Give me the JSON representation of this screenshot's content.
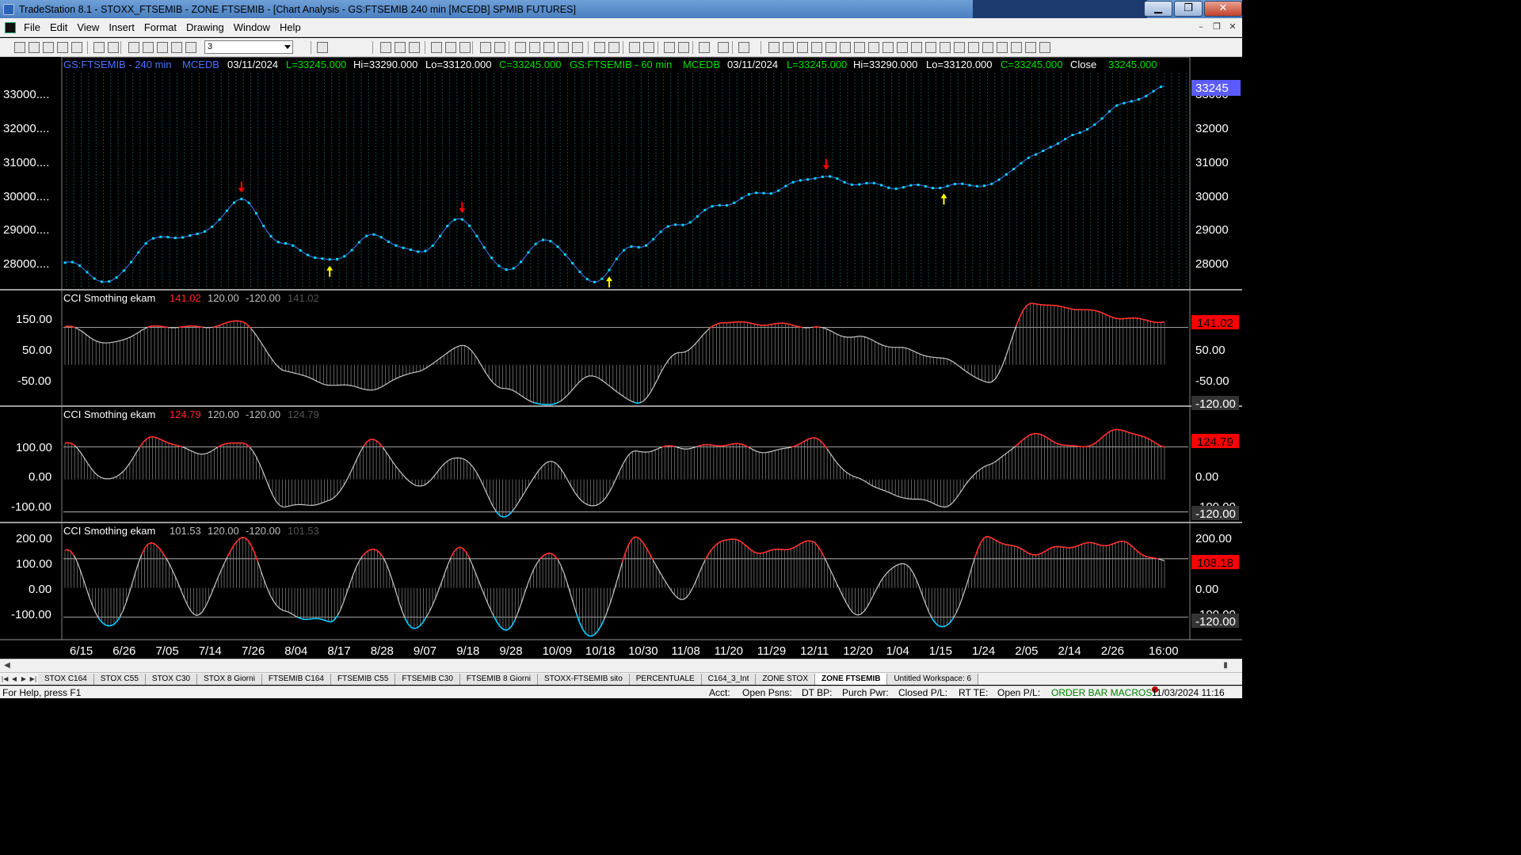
{
  "window": {
    "title": "TradeStation 8.1 - STOXX_FTSEMIB - ZONE FTSEMIB - [Chart Analysis - GS:FTSEMIB  240 min  [MCEDB] SPMIB FUTURES]",
    "min_label": "▁",
    "max_label": "❐",
    "close_label": "✕"
  },
  "menu": [
    "File",
    "Edit",
    "View",
    "Insert",
    "Format",
    "Drawing",
    "Window",
    "Help"
  ],
  "toolbar": {
    "combo_value": "3"
  },
  "chart": {
    "header": {
      "sym1": "GS:FTSEMIB - 240 min",
      "src1": "MCEDB",
      "date1": "03/11/2024",
      "L1": "L=33245.000",
      "H1": "Hi=33290.000",
      "Lo1": "Lo=33120.000",
      "C1": "C=33245.000",
      "sym2": "GS:FTSEMIB - 60 min",
      "src2": "MCEDB",
      "date2": "03/11/2024",
      "L2": "L=33245.000",
      "H2": "Hi=33290.000",
      "Lo2": "Lo=33120.000",
      "C2": "C=33245.000",
      "close_label": "Close",
      "close_value": "33245.000"
    },
    "price_labels_left": [
      "33000....",
      "32000....",
      "31000....",
      "30000....",
      "29000....",
      "28000...."
    ],
    "price_labels_right": [
      "33000",
      "32000",
      "31000",
      "30000",
      "29000",
      "28000"
    ],
    "price_marker": "33245",
    "panels": [
      {
        "title": "CCI Smothing ekam",
        "val": "141.02",
        "level_hi": "120.00",
        "level_lo": "-120.00",
        "val2": "141.02",
        "labels": [
          "150.00",
          "50.00",
          "-50.00"
        ],
        "right_labels": [
          "50.00",
          "-50.00",
          "-120.00"
        ],
        "marker": "141.02"
      },
      {
        "title": "CCI Smothing ekam",
        "val": "124.79",
        "level_hi": "120.00",
        "level_lo": "-120.00",
        "val2": "124.79",
        "labels": [
          "100.00",
          "0.00",
          "-100.00"
        ],
        "right_labels": [
          "0.00",
          "-100.00",
          "-120.00"
        ],
        "marker": "124.79"
      },
      {
        "title": "CCI Smothing ekam",
        "val": "101.53",
        "level_hi": "120.00",
        "level_lo": "-120.00",
        "val2": "101.53",
        "labels": [
          "200.00",
          "100.00",
          "0.00",
          "-100.00"
        ],
        "right_labels": [
          "200.00",
          "0.00",
          "-100.00",
          "-120.00"
        ],
        "marker": "108.18"
      }
    ],
    "x_labels": [
      "6/15",
      "6/26",
      "7/05",
      "7/14",
      "7/26",
      "8/04",
      "8/17",
      "8/28",
      "9/07",
      "9/18",
      "9/28",
      "10/09",
      "10/18",
      "10/30",
      "11/08",
      "11/20",
      "11/29",
      "12/11",
      "12/20",
      "1/04",
      "1/15",
      "1/24",
      "2/05",
      "2/14",
      "2/26",
      "16:00"
    ]
  },
  "tabs": [
    "STOX C164",
    "STOX C55",
    "STOX  C30",
    "STOX  8 Giorni",
    "FTSEMIB C164",
    "FTSEMIB C55",
    "FTSEMIB C30",
    "FTSEMIB  8 Giorni",
    "STOXX-FTSEMIB sito",
    "PERCENTUALE",
    "C164_3_Int",
    "ZONE STOX",
    "ZONE FTSEMIB",
    "Untitled Workspace:  6"
  ],
  "active_tab": "ZONE FTSEMIB",
  "status": {
    "help": "For Help, press F1",
    "acct": "Acct:",
    "open_psns": "Open Psns:",
    "dt_bp": "DT BP:",
    "purch_pwr": "Purch Pwr:",
    "closed_pl": "Closed P/L:",
    "rt_te": "RT TE:",
    "open_pl": "Open P/L:",
    "macros": "ORDER BAR  MACROS",
    "datetime": "11/03/2024 11:16"
  },
  "colors": {
    "price_line": "#00d8ff",
    "up_arrow": "#ffff00",
    "down_arrow": "#ff0000",
    "cci_over": "#ff2a2a",
    "cci_under": "#00ccff",
    "cci_mid": "#c8c8c8",
    "header_blue": "#4a74ff",
    "header_green": "#00e000"
  },
  "chart_data": [
    {
      "type": "line",
      "title": "GS:FTSEMIB - 240 min",
      "x": [
        "6/15",
        "6/26",
        "7/05",
        "7/14",
        "7/26",
        "8/04",
        "8/17",
        "8/28",
        "9/07",
        "9/18",
        "9/28",
        "10/09",
        "10/18",
        "10/30",
        "11/08",
        "11/20",
        "11/29",
        "12/11",
        "12/20",
        "1/04",
        "1/15",
        "1/24",
        "2/05",
        "2/14",
        "2/26",
        "16:00"
      ],
      "series": [
        {
          "name": "Close",
          "values": [
            28200,
            27700,
            28900,
            29000,
            30050,
            28700,
            28300,
            29000,
            28500,
            29500,
            28000,
            28900,
            27700,
            28700,
            29400,
            29900,
            30300,
            30700,
            30500,
            30450,
            30400,
            30500,
            31300,
            31900,
            32800,
            33245
          ]
        }
      ],
      "ylim": [
        27500,
        33700
      ]
    },
    {
      "type": "line",
      "title": "CCI Smothing ekam",
      "x": [
        "6/15",
        "6/26",
        "7/05",
        "7/14",
        "7/26",
        "8/04",
        "8/17",
        "8/28",
        "9/07",
        "9/18",
        "9/28",
        "10/09",
        "10/18",
        "10/30",
        "11/08",
        "11/20",
        "11/29",
        "12/11",
        "12/20",
        "1/04",
        "1/15",
        "1/24",
        "2/05",
        "2/14",
        "2/26",
        "16:00"
      ],
      "series": [
        {
          "name": "CCI",
          "values": [
            120,
            70,
            120,
            120,
            140,
            -20,
            -60,
            -80,
            -20,
            60,
            -80,
            -130,
            -40,
            -120,
            40,
            140,
            130,
            120,
            90,
            50,
            20,
            -60,
            200,
            180,
            150,
            141.02
          ]
        }
      ],
      "ylim": [
        -120,
        200
      ]
    },
    {
      "type": "line",
      "title": "CCI Smothing ekam",
      "x": [
        "6/15",
        "6/26",
        "7/05",
        "7/14",
        "7/26",
        "8/04",
        "8/17",
        "8/28",
        "9/07",
        "9/18",
        "9/28",
        "10/09",
        "10/18",
        "10/30",
        "11/08",
        "11/20",
        "11/29",
        "12/11",
        "12/20",
        "1/04",
        "1/15",
        "1/24",
        "2/05",
        "2/14",
        "2/26",
        "16:00"
      ],
      "series": [
        {
          "name": "CCI",
          "values": [
            130,
            0,
            150,
            100,
            140,
            -100,
            -80,
            140,
            -20,
            80,
            -130,
            60,
            -100,
            100,
            120,
            130,
            100,
            150,
            0,
            -60,
            -100,
            60,
            160,
            120,
            180,
            124.79
          ]
        }
      ],
      "ylim": [
        -150,
        200
      ]
    },
    {
      "type": "line",
      "title": "CCI Smothing ekam",
      "x": [
        "6/15",
        "6/26",
        "7/05",
        "7/14",
        "7/26",
        "8/04",
        "8/17",
        "8/28",
        "9/07",
        "9/18",
        "9/28",
        "10/09",
        "10/18",
        "10/30",
        "11/08",
        "11/20",
        "11/29",
        "12/11",
        "12/20",
        "1/04",
        "1/15",
        "1/24",
        "2/05",
        "2/14",
        "2/26",
        "16:00"
      ],
      "series": [
        {
          "name": "CCI",
          "values": [
            150,
            -160,
            180,
            -100,
            200,
            -100,
            -140,
            170,
            -170,
            160,
            -170,
            150,
            -200,
            200,
            -40,
            200,
            150,
            180,
            -100,
            100,
            -160,
            200,
            150,
            170,
            190,
            101.53
          ]
        }
      ],
      "ylim": [
        -200,
        230
      ]
    }
  ]
}
